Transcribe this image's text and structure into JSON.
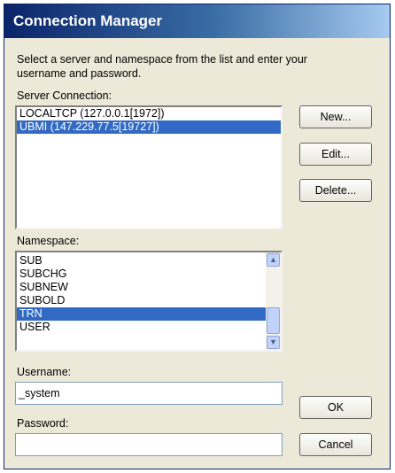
{
  "window": {
    "title": "Connection Manager"
  },
  "instructions": "Select a server and namespace from the list and enter your username and password.",
  "server": {
    "label": "Server Connection:",
    "items": [
      "LOCALTCP (127.0.0.1[1972])",
      "UBMI (147.229.77.5[19727])"
    ],
    "selected_index": 1
  },
  "buttons": {
    "new": "New...",
    "edit": "Edit...",
    "delete": "Delete...",
    "ok": "OK",
    "cancel": "Cancel"
  },
  "namespace": {
    "label": "Namespace:",
    "items": [
      "SUB",
      "SUBCHG",
      "SUBNEW",
      "SUBOLD",
      "TRN",
      "USER"
    ],
    "selected_index": 4
  },
  "username": {
    "label": "Username:",
    "value": "_system"
  },
  "password": {
    "label": "Password:",
    "value": ""
  }
}
